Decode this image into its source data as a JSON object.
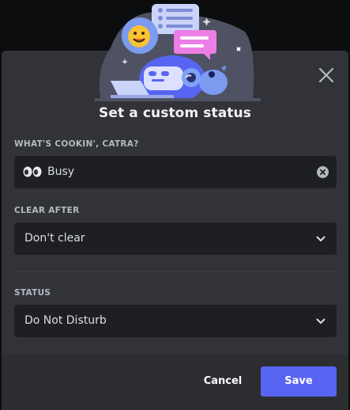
{
  "modal": {
    "title": "Set a custom status",
    "close_icon": "close-icon"
  },
  "custom_status": {
    "label": "WHAT'S COOKIN', CATRA?",
    "emoji": "eyes-emoji",
    "value": "Busy",
    "clear_icon": "clear-circle-icon"
  },
  "clear_after": {
    "label": "CLEAR AFTER",
    "selected": "Don't clear"
  },
  "status": {
    "label": "STATUS",
    "selected": "Do Not Disturb"
  },
  "footer": {
    "cancel_label": "Cancel",
    "save_label": "Save"
  },
  "colors": {
    "background": "#313338",
    "footer": "#2b2d31",
    "input": "#1e1f22",
    "accent": "#5865f2",
    "text": "#dbdee1",
    "label": "#b5bac1"
  }
}
